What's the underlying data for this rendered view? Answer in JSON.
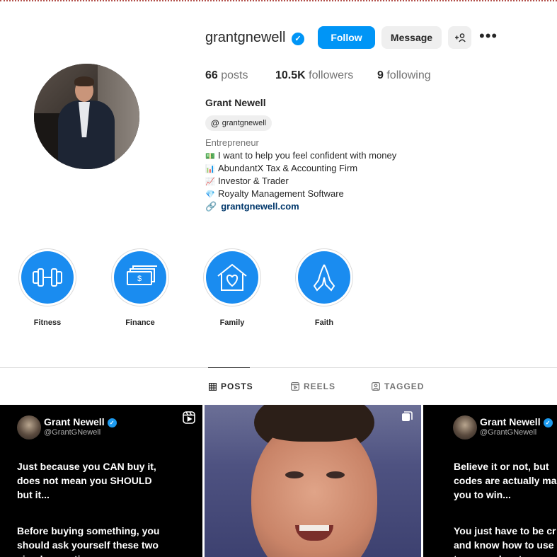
{
  "profile": {
    "username": "grantgnewell",
    "follow_label": "Follow",
    "message_label": "Message",
    "add_user_label": "+👤",
    "more_label": "•••",
    "posts_count": "66",
    "posts_label": "posts",
    "followers_count": "10.5K",
    "followers_label": "followers",
    "following_count": "9",
    "following_label": "following",
    "full_name": "Grant Newell",
    "threads_handle": "grantgnewell",
    "category": "Entrepreneur",
    "bio_lines": [
      {
        "emoji": "💵",
        "text": "I want to help you feel confident with money"
      },
      {
        "emoji": "📊",
        "text": "AbundantX Tax & Accounting Firm"
      },
      {
        "emoji": "📈",
        "text": "Investor & Trader"
      },
      {
        "emoji": "💎",
        "text": "Royalty Management Software"
      }
    ],
    "website": "grantgnewell.com"
  },
  "highlights": [
    {
      "label": "Fitness",
      "icon": "dumbbell-icon"
    },
    {
      "label": "Finance",
      "icon": "money-stack-icon"
    },
    {
      "label": "Family",
      "icon": "house-heart-icon"
    },
    {
      "label": "Faith",
      "icon": "praying-hands-icon"
    }
  ],
  "tabs": [
    {
      "label": "POSTS",
      "icon": "grid-icon",
      "active": true
    },
    {
      "label": "REELS",
      "icon": "reels-icon",
      "active": false
    },
    {
      "label": "TAGGED",
      "icon": "tagged-icon",
      "active": false
    }
  ],
  "posts": [
    {
      "author": "Grant Newell",
      "handle": "@GrantGNewell",
      "text_1": "Just because you CAN buy it,\ndoes not mean you SHOULD\nbut it...",
      "text_2": "Before buying something, you\nshould ask yourself these two\nsimple questions..."
    },
    {
      "author": "Grant Newell",
      "handle": "@GrantGNewell",
      "text_1": "Believe it or not, but\ncodes are actually ma\nyou to win...",
      "text_2": "You just have to be cr\nand know how to use\nto your advantage..."
    }
  ],
  "colors": {
    "accent": "#0095f6",
    "highlight_fill": "#1a8cf0",
    "link": "#00376b"
  }
}
